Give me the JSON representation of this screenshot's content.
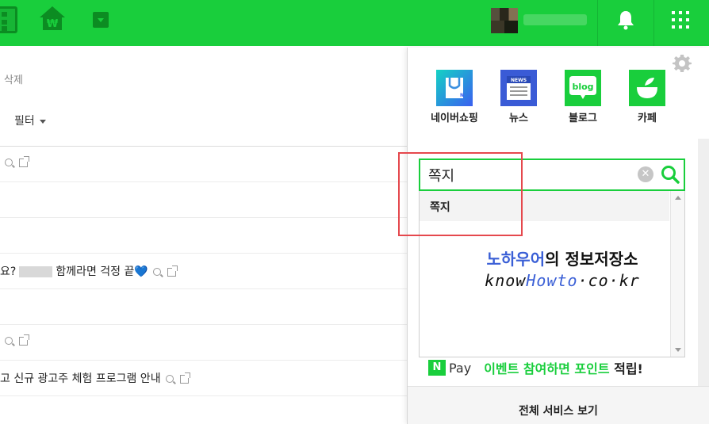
{
  "colors": {
    "brand_green": "#19ce3c",
    "highlight_red": "#e5484d",
    "link_blue": "#3a5fd6"
  },
  "topbar": {
    "left_icons": [
      "naver-logo-icon",
      "home-won-icon",
      "dropdown-icon"
    ],
    "right_icons": [
      "avatar",
      "bell-icon",
      "app-grid-icon"
    ]
  },
  "list": {
    "delete_label": "삭제",
    "filter_label": "필터",
    "rows": [
      {
        "text": ""
      },
      {
        "text": ""
      },
      {
        "text": ""
      },
      {
        "text_before": "요?",
        "text_after": "함께라면 걱정 끝",
        "emoji": "💙"
      },
      {
        "text": ""
      },
      {
        "text": ""
      },
      {
        "text": "고 신규 광고주 체험 프로그램 안내"
      }
    ]
  },
  "panel": {
    "services": [
      {
        "label": "네이버쇼핑",
        "icon": "shopping-bag-icon"
      },
      {
        "label": "뉴스",
        "icon": "news-icon"
      },
      {
        "label": "블로그",
        "icon": "blog-icon"
      },
      {
        "label": "카페",
        "icon": "cafe-icon"
      }
    ],
    "news_icon_text": "NEWS",
    "blog_icon_text": "blog",
    "search": {
      "value": "쪽지"
    },
    "autocomplete": [
      "쪽지"
    ],
    "watermark": {
      "line1_blue": "노하우어",
      "line1_rest": "의 정보저장소",
      "line2_pre": "know",
      "line2_blue": "Howto",
      "line2_post": "·co·kr"
    },
    "pay": {
      "logo": "N",
      "word": "Pay",
      "promo_green": "이벤트 참여하면 포인트",
      "promo_dark": " 적립!"
    },
    "footer": "전체 서비스 보기"
  }
}
